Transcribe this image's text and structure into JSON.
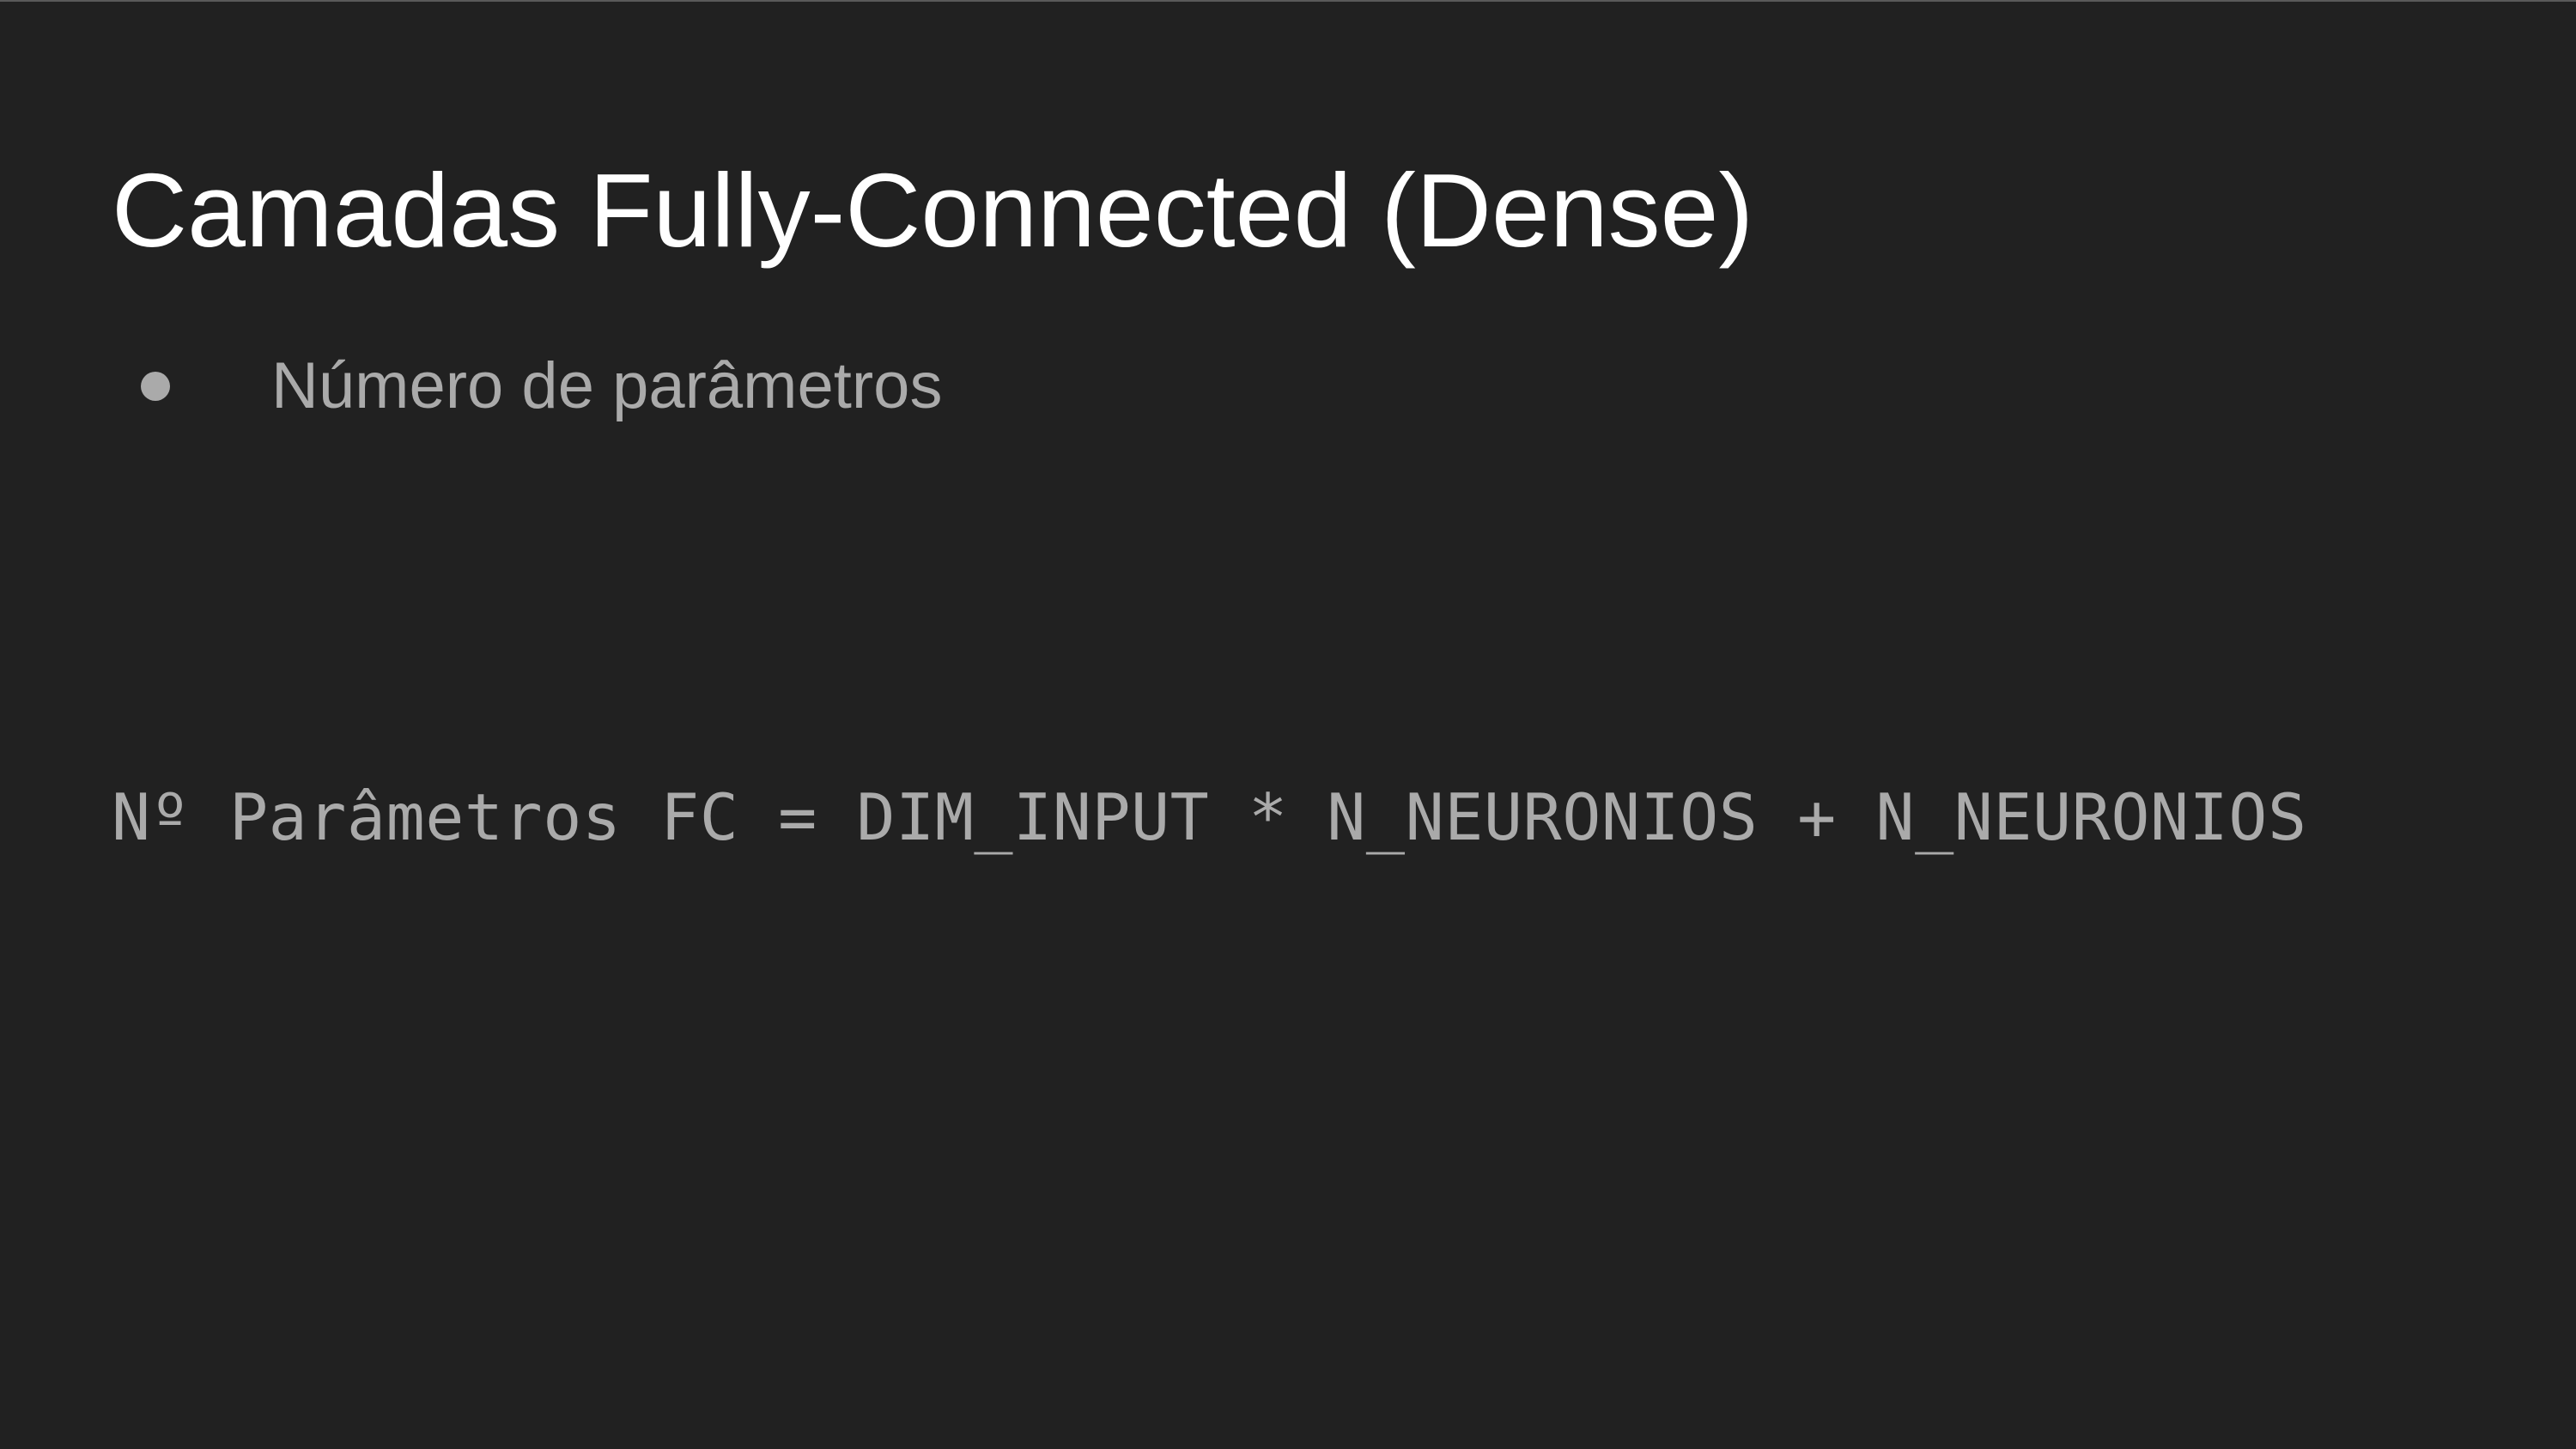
{
  "slide": {
    "title": "Camadas Fully-Connected (Dense)",
    "bullets": [
      {
        "text": "Número de parâmetros"
      }
    ],
    "formula": "Nº Parâmetros FC = DIM_INPUT * N_NEURONIOS + N_NEURONIOS"
  },
  "colors": {
    "background": "#212121",
    "title": "#ffffff",
    "body_text": "#aaaaaa"
  },
  "icons": {
    "bullet": "bullet-dot-icon"
  }
}
